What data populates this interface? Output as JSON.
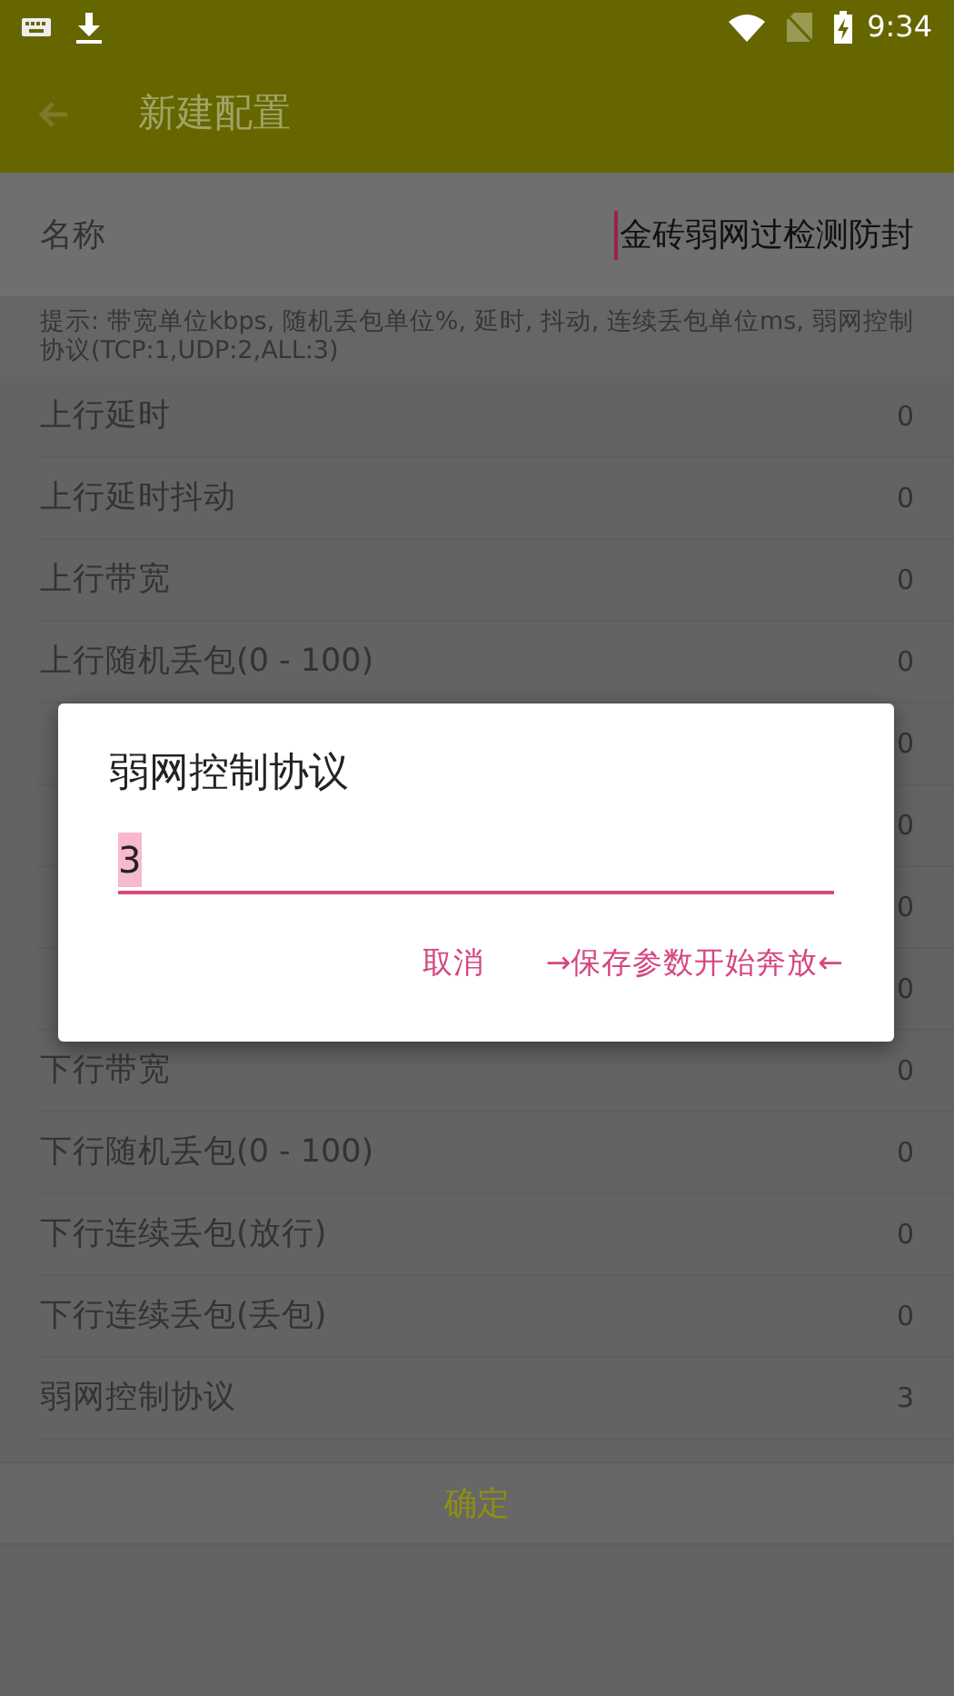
{
  "status_bar": {
    "time": "9:34"
  },
  "app_bar": {
    "title": "新建配置"
  },
  "name_field": {
    "label": "名称",
    "value": "金砖弱网过检测防封"
  },
  "hint": "提示: 带宽单位kbps, 随机丢包单位%, 延时, 抖动, 连续丢包单位ms, 弱网控制协议(TCP:1,UDP:2,ALL:3)",
  "rows": [
    {
      "label": "上行延时",
      "value": "0"
    },
    {
      "label": "上行延时抖动",
      "value": "0"
    },
    {
      "label": "上行带宽",
      "value": "0"
    },
    {
      "label": "上行随机丢包(0 - 100)",
      "value": "0"
    },
    {
      "value": "0"
    },
    {
      "value": "0"
    },
    {
      "value": "0"
    },
    {
      "value": "0"
    },
    {
      "label": "下行带宽",
      "value": "0"
    },
    {
      "label": "下行随机丢包(0 - 100)",
      "value": "0"
    },
    {
      "label": "下行连续丢包(放行)",
      "value": "0"
    },
    {
      "label": "下行连续丢包(丢包)",
      "value": "0"
    },
    {
      "label": "弱网控制协议",
      "value": "3"
    }
  ],
  "confirm_button": "确定",
  "dialog": {
    "title": "弱网控制协议",
    "value": "3",
    "buttons": [
      "取消",
      "→保存参数开始奔放←"
    ]
  }
}
